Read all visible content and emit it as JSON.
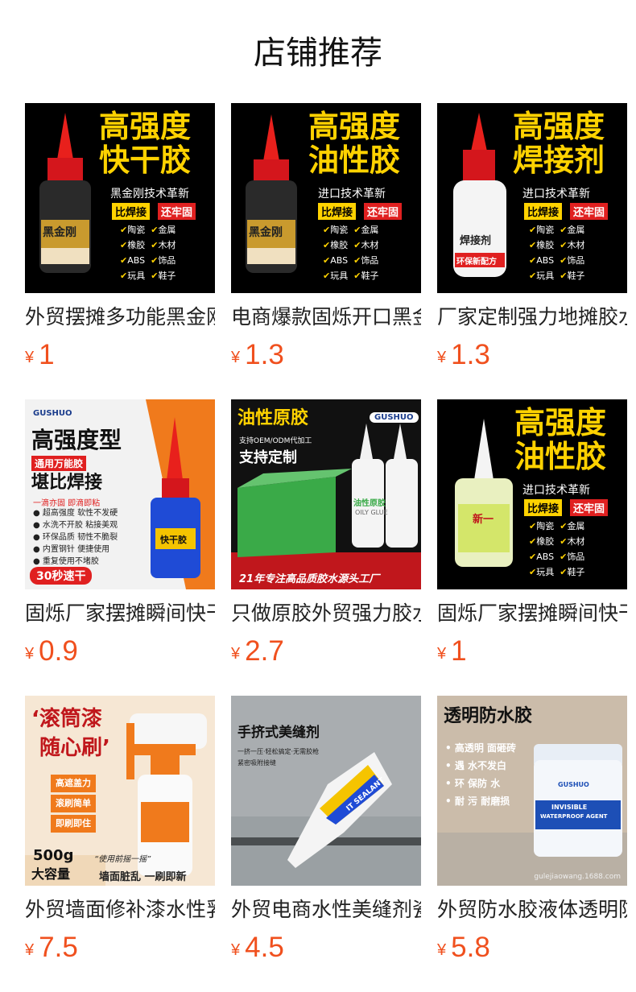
{
  "section": {
    "title": "店铺推荐"
  },
  "currency_symbol": "¥",
  "colors": {
    "price": "#f0501e",
    "title": "#111111"
  },
  "products": [
    {
      "name": "外贸摆摊多功能黑金刚",
      "price": "1",
      "image": {
        "headline1": "高强度",
        "headline2": "快干胶",
        "subtitle": "黑金刚技术革新",
        "tag_yellow": "比焊接",
        "tag_red": "还牢固",
        "features": [
          "陶瓷",
          "金属",
          "橡胶",
          "木材",
          "ABS",
          "饰品",
          "玩具",
          "鞋子"
        ],
        "bottle_label": "黑金刚"
      }
    },
    {
      "name": "电商爆款固烁开口黑金",
      "price": "1.3",
      "image": {
        "headline1": "高强度",
        "headline2": "油性胶",
        "subtitle": "进口技术革新",
        "tag_yellow": "比焊接",
        "tag_red": "还牢固",
        "features": [
          "陶瓷",
          "金属",
          "橡胶",
          "木材",
          "ABS",
          "饰品",
          "玩具",
          "鞋子"
        ],
        "bottle_label": "黑金刚"
      }
    },
    {
      "name": "厂家定制强力地摊胶水",
      "price": "1.3",
      "image": {
        "headline1": "高强度",
        "headline2": "焊接剂",
        "subtitle": "进口技术革新",
        "tag_yellow": "比焊接",
        "tag_red": "还牢固",
        "features": [
          "陶瓷",
          "金属",
          "橡胶",
          "木材",
          "ABS",
          "饰品",
          "玩具",
          "鞋子"
        ],
        "bottle_label": "焊接剂",
        "bottle_badge": "环保新配方"
      }
    },
    {
      "name": "固烁厂家摆摊瞬间快干",
      "price": "0.9",
      "image": {
        "brand": "GUSHUO",
        "headline1": "高强度型",
        "tag1": "通用万能胶",
        "headline2": "堪比焊接",
        "tagline": "一滴亦固 即滴即粘",
        "features": [
          "超高强度 软性不发硬",
          "水洗不开胶 粘接美观",
          "环保品质 韧性不脆裂",
          "内置钢针 便捷使用",
          "重复使用不堵胶"
        ],
        "footer": "30秒速干",
        "bottle_label": "快干胶"
      }
    },
    {
      "name": "只做原胶外贸强力胶水",
      "price": "2.7",
      "image": {
        "headline1": "油性原胶",
        "brand": "GUSHUO",
        "small": "支持OEM/ODM代加工",
        "headline2": "支持定制",
        "footer": "21年专注高品质胶水源头工厂",
        "bottle_label": "油性原胶",
        "bottle_sub": "OILY GLUE"
      }
    },
    {
      "name": "固烁厂家摆摊瞬间快干",
      "price": "1",
      "image": {
        "headline1": "高强度",
        "headline2": "油性胶",
        "subtitle": "进口技术革新",
        "tag_yellow": "比焊接",
        "tag_red": "还牢固",
        "features": [
          "陶瓷",
          "金属",
          "橡胶",
          "木材",
          "ABS",
          "饰品",
          "玩具",
          "鞋子"
        ],
        "bottle_label": "新一"
      }
    },
    {
      "name": "外贸墙面修补漆水性乳胶",
      "price": "7.5",
      "image": {
        "headline1": "‘滚筒漆",
        "headline2": "随心刷’",
        "features": [
          "高遮盖力",
          "滚刷简单",
          "即刷即住"
        ],
        "capacity": "500g",
        "capacity_label": "大容量",
        "note": "“使用前摇一摇”",
        "footer": "墙面脏乱 一刷即新"
      }
    },
    {
      "name": "外贸电商水性美缝剂瓷砖",
      "price": "4.5",
      "image": {
        "headline1": "手挤式美缝剂",
        "small": "一挤一压·轻松搞定·无需胶枪",
        "small2": "紧密吸附接缝",
        "bottle_text": "IT SEALANT"
      }
    },
    {
      "name": "外贸防水胶液体透明防水",
      "price": "5.8",
      "image": {
        "headline1": "透明防水胶",
        "features": [
          "高透明 面砸砖",
          "遇 水不发白",
          "环 保防 水",
          "耐 污 耐磨损"
        ],
        "jar_brand": "GUSHUO",
        "jar_title1": "INVISIBLE",
        "jar_title2": "WATERPROOF AGENT",
        "watermark": "gulejiaowang.1688.com"
      }
    }
  ]
}
